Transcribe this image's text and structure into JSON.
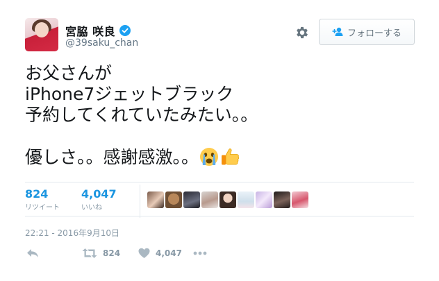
{
  "user": {
    "display_name": "宮脇 咲良",
    "handle": "@39saku_chan",
    "verified": true
  },
  "follow_button": {
    "label": "フォローする"
  },
  "tweet": {
    "lines": [
      "お父さんが",
      "iPhone7ジェットブラック",
      "予約してくれていたみたい。。",
      "",
      "優しさ。。感謝感激。。"
    ],
    "emojis": [
      "crying-face",
      "thumbs-up"
    ]
  },
  "stats": {
    "retweets": {
      "count": "824",
      "label": "リツイート"
    },
    "likes": {
      "count": "4,047",
      "label": "いいね"
    }
  },
  "timestamp": "22:21 - 2016年9月10日",
  "actions": {
    "retweet_count": "824",
    "like_count": "4,047"
  },
  "icons": {
    "gear": "gear-icon",
    "reply": "reply-icon",
    "retweet": "retweet-icon",
    "like": "heart-icon",
    "more": "more-icon",
    "verified": "verified-badge-icon"
  },
  "colors": {
    "link": "#1b95e0",
    "muted": "#8899a6",
    "action_icon": "#aab8c2"
  }
}
